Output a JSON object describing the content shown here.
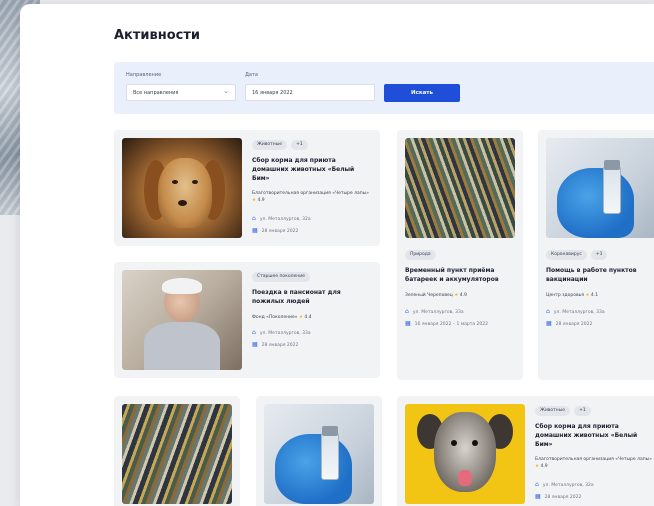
{
  "page": {
    "title": "Активности"
  },
  "filters": {
    "direction_label": "Направление",
    "direction_value": "Все направления",
    "date_label": "Дата",
    "date_value": "16 января 2022",
    "search_label": "Искать"
  },
  "cards": [
    {
      "tags": [
        "Животные",
        "+1"
      ],
      "title": "Сбор корма для приюта домашних животных «Белый Бим»",
      "org": "Благотворительная организация «Четыре лапы»",
      "rating": "4.9",
      "address": "ул. Металлургов, 32а",
      "date": "28 января 2022"
    },
    {
      "tags": [
        "Старшее поколение"
      ],
      "title": "Поездка в пансионат для пожилых людей",
      "org": "Фонд «Поколение»",
      "rating": "4.4",
      "address": "ул. Металлургов, 33а",
      "date": "28 января 2022"
    },
    {
      "tags": [
        "Природа"
      ],
      "title": "Временный пункт приёма батареек и аккумуляторов",
      "org": "Зеленый Череповец",
      "rating": "4.9",
      "address": "ул. Металлургов, 33а",
      "date": "16 января 2022 – 1 марта 2022"
    },
    {
      "tags": [
        "Коронавирус",
        "+1"
      ],
      "title": "Помощь в работе пунктов вакцинации",
      "org": "Центр здоровья",
      "rating": "4.1",
      "address": "ул. Металлургов, 33а",
      "date": "28 января 2022"
    },
    {
      "tags": [
        "Животные",
        "+1"
      ],
      "title": "Сбор корма для приюта домашних животных «Белый Бим»",
      "org": "Благотворительная организация «Четыре лапы»",
      "rating": "4.9",
      "address": "ул. Металлургов, 32а",
      "date": "28 января 2022"
    }
  ],
  "icons": {
    "location": "building-icon",
    "calendar": "calendar-icon",
    "star": "star-icon"
  },
  "colors": {
    "accent": "#1f4fd8",
    "filter_bg": "#eaf0fb",
    "card_bg": "#f2f3f5",
    "star": "#f2b90c"
  }
}
